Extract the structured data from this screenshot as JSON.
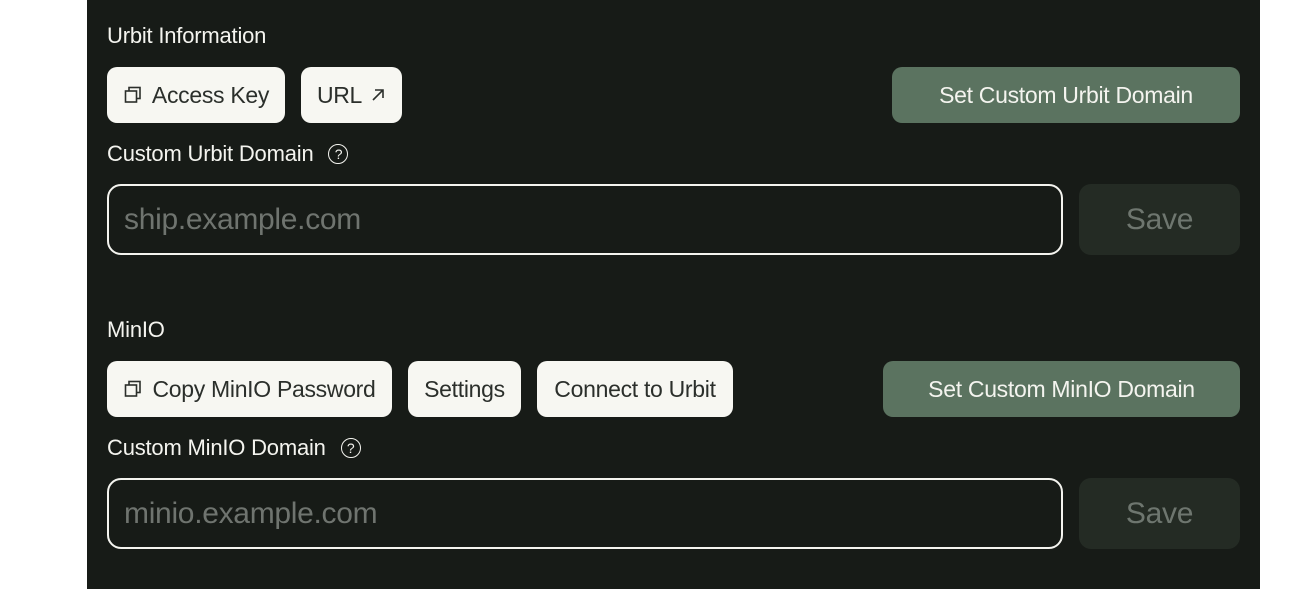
{
  "urbit": {
    "section_title": "Urbit Information",
    "access_key_label": "Access Key",
    "url_label": "URL",
    "set_domain_label": "Set Custom Urbit Domain",
    "domain_field_label": "Custom Urbit Domain",
    "domain_placeholder": "ship.example.com",
    "save_label": "Save"
  },
  "minio": {
    "section_title": "MinIO",
    "copy_password_label": "Copy MinIO Password",
    "settings_label": "Settings",
    "connect_label": "Connect to Urbit",
    "set_domain_label": "Set Custom MinIO Domain",
    "domain_field_label": "Custom MinIO Domain",
    "domain_placeholder": "minio.example.com",
    "save_label": "Save"
  },
  "help_glyph": "?",
  "icons": {
    "copy": "copy-icon",
    "external_link": "arrow-up-right-icon",
    "help": "question-circle-icon"
  },
  "colors": {
    "panel_background": "#171b17",
    "primary_green": "#5b7360",
    "light_button": "#f7f7f2",
    "save_disabled": "#242b24"
  }
}
